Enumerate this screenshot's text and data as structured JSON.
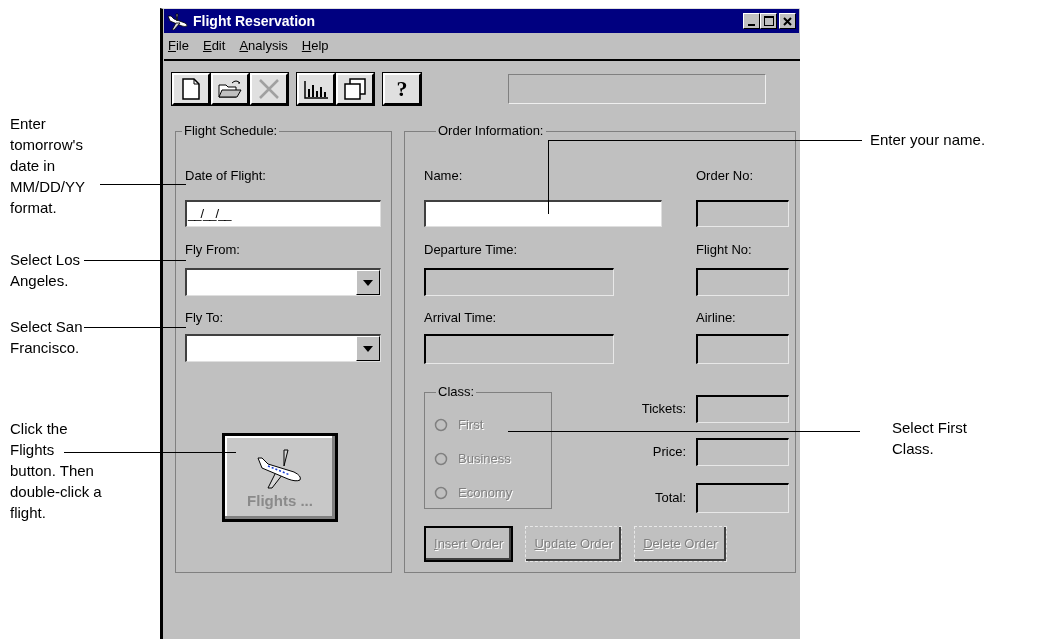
{
  "window": {
    "title": "Flight Reservation"
  },
  "menu": [
    {
      "label": "File"
    },
    {
      "label": "Edit"
    },
    {
      "label": "Analysis"
    },
    {
      "label": "Help"
    }
  ],
  "toolbar": [
    {
      "kind": "new",
      "disabled": false
    },
    {
      "kind": "open",
      "disabled": false
    },
    {
      "kind": "delete",
      "disabled": true
    },
    {
      "kind": "chart",
      "disabled": false
    },
    {
      "kind": "copy",
      "disabled": false
    },
    {
      "kind": "help",
      "glyph": "?",
      "disabled": false
    }
  ],
  "flight_schedule": {
    "title": "Flight Schedule:",
    "date_label": "Date of Flight:",
    "date_value": "__/__/__",
    "from_label": "Fly From:",
    "to_label": "Fly To:",
    "flights_button": {
      "label": "Flights ...",
      "disabled": true
    }
  },
  "order_information": {
    "title": "Order Information:",
    "name": {
      "label": "Name:",
      "disabled": false
    },
    "order_no": {
      "label": "Order No:",
      "disabled": true
    },
    "departure_time": {
      "label": "Departure Time:",
      "disabled": true
    },
    "flight_no": {
      "label": "Flight No:",
      "disabled": true
    },
    "arrival_time": {
      "label": "Arrival Time:",
      "disabled": true
    },
    "airline": {
      "label": "Airline:",
      "disabled": true
    },
    "class": {
      "title": "Class:",
      "options": [
        {
          "label": "First",
          "selected": false,
          "disabled": true
        },
        {
          "label": "Business",
          "selected": false,
          "disabled": true
        },
        {
          "label": "Economy",
          "selected": false,
          "disabled": true
        }
      ]
    },
    "tickets": {
      "label": "Tickets:",
      "disabled": true
    },
    "price": {
      "label": "Price:",
      "disabled": true
    },
    "total": {
      "label": "Total:",
      "disabled": true
    },
    "buttons": [
      {
        "label": "Insert Order",
        "disabled": true,
        "default": true
      },
      {
        "label": "Update Order",
        "disabled": true,
        "default": false
      },
      {
        "label": "Delete Order",
        "disabled": true,
        "default": false
      }
    ]
  },
  "annotations_left": [
    {
      "lines": [
        "Enter",
        "tomorrow's",
        "date in",
        "MM/DD/YY",
        "format."
      ]
    },
    {
      "lines": [
        "Select Los",
        "Angeles."
      ]
    },
    {
      "lines": [
        "Select San",
        "Francisco."
      ]
    },
    {
      "lines": [
        "Click the",
        "Flights",
        "button. Then",
        "double-click a",
        "flight."
      ]
    }
  ],
  "annotations_right": [
    {
      "lines": [
        "Enter your name."
      ]
    },
    {
      "lines": [
        "Select First",
        "Class."
      ]
    }
  ]
}
